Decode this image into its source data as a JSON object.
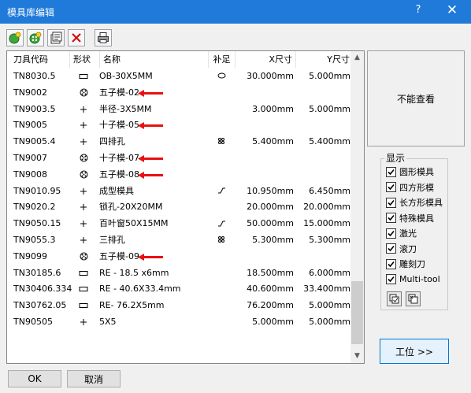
{
  "window": {
    "title": "模具库编辑",
    "help_label": "?",
    "close_label": "✕"
  },
  "toolbar": {
    "buttons": [
      {
        "icon": "add-tool-icon"
      },
      {
        "icon": "add-multi-tool-icon"
      },
      {
        "icon": "edit-properties-icon"
      },
      {
        "icon": "delete-icon"
      },
      {
        "icon": "print-icon"
      }
    ]
  },
  "table": {
    "headers": {
      "code": "刀具代码",
      "shape": "形状",
      "name": "名称",
      "compensation": "补足",
      "x_size": "X尺寸",
      "y_size": "Y尺寸"
    },
    "rows": [
      {
        "code": "TN8030.5",
        "shape": "obround",
        "name": "OB-30X5MM",
        "comp": "ellipse",
        "x": "30.000mm",
        "y": "5.000mm",
        "arrow": false
      },
      {
        "code": "TN9002",
        "shape": "five-circle",
        "name": "五子模-02",
        "comp": "",
        "x": "",
        "y": "",
        "arrow": true
      },
      {
        "code": "TN9003.5",
        "shape": "cross",
        "name": "半径-3X5MM",
        "comp": "",
        "x": "3.000mm",
        "y": "5.000mm",
        "arrow": false
      },
      {
        "code": "TN9005",
        "shape": "cross",
        "name": "十子模-05",
        "comp": "",
        "x": "",
        "y": "",
        "arrow": true
      },
      {
        "code": "TN9005.4",
        "shape": "cross",
        "name": "四排孔",
        "comp": "four-dots",
        "x": "5.400mm",
        "y": "5.400mm",
        "arrow": false
      },
      {
        "code": "TN9007",
        "shape": "five-circle",
        "name": "十子模-07",
        "comp": "",
        "x": "",
        "y": "",
        "arrow": true
      },
      {
        "code": "TN9008",
        "shape": "five-circle",
        "name": "五子模-08",
        "comp": "",
        "x": "",
        "y": "",
        "arrow": true
      },
      {
        "code": "TN9010.95",
        "shape": "cross",
        "name": "成型模具",
        "comp": "form",
        "x": "10.950mm",
        "y": "6.450mm",
        "arrow": false
      },
      {
        "code": "TN9020.2",
        "shape": "cross",
        "name": "锁孔-20X20MM",
        "comp": "",
        "x": "20.000mm",
        "y": "20.000mm",
        "arrow": false
      },
      {
        "code": "TN9050.15",
        "shape": "cross",
        "name": "百叶窗50X15MM",
        "comp": "form",
        "x": "50.000mm",
        "y": "15.000mm",
        "arrow": false
      },
      {
        "code": "TN9055.3",
        "shape": "cross",
        "name": "三排孔",
        "comp": "four-dots",
        "x": "5.300mm",
        "y": "5.300mm",
        "arrow": false
      },
      {
        "code": "TN9099",
        "shape": "five-circle",
        "name": "五子模-09",
        "comp": "",
        "x": "",
        "y": "",
        "arrow": true
      },
      {
        "code": "TN30185.6",
        "shape": "rectangle",
        "name": "RE - 18.5 x6mm",
        "comp": "",
        "x": "18.500mm",
        "y": "6.000mm",
        "arrow": false
      },
      {
        "code": "TN30406.334",
        "shape": "rectangle",
        "name": "RE - 40.6X33.4mm",
        "comp": "",
        "x": "40.600mm",
        "y": "33.400mm",
        "arrow": false
      },
      {
        "code": "TN30762.05",
        "shape": "rectangle",
        "name": "RE- 76.2X5mm",
        "comp": "",
        "x": "76.200mm",
        "y": "5.000mm",
        "arrow": false
      },
      {
        "code": "TN90505",
        "shape": "cross",
        "name": "5X5",
        "comp": "",
        "x": "5.000mm",
        "y": "5.000mm",
        "arrow": false
      }
    ]
  },
  "preview": {
    "text": "不能查看"
  },
  "display": {
    "label": "显示",
    "options": [
      {
        "label": "圆形模具",
        "checked": true
      },
      {
        "label": "四方形模",
        "checked": true
      },
      {
        "label": "长方形模具",
        "checked": true
      },
      {
        "label": "特殊模具",
        "checked": true
      },
      {
        "label": "激光",
        "checked": true
      },
      {
        "label": "滚刀",
        "checked": true
      },
      {
        "label": "雕刻刀",
        "checked": true
      },
      {
        "label": "Multi-tool",
        "checked": true
      }
    ],
    "small_buttons": [
      {
        "icon": "select-all-icon"
      },
      {
        "icon": "invert-selection-icon"
      }
    ]
  },
  "buttons": {
    "station": "工位 >>",
    "ok": "OK",
    "cancel": "取消"
  },
  "colors": {
    "titlebar": "#1f7ad9",
    "arrow": "#e81010"
  }
}
